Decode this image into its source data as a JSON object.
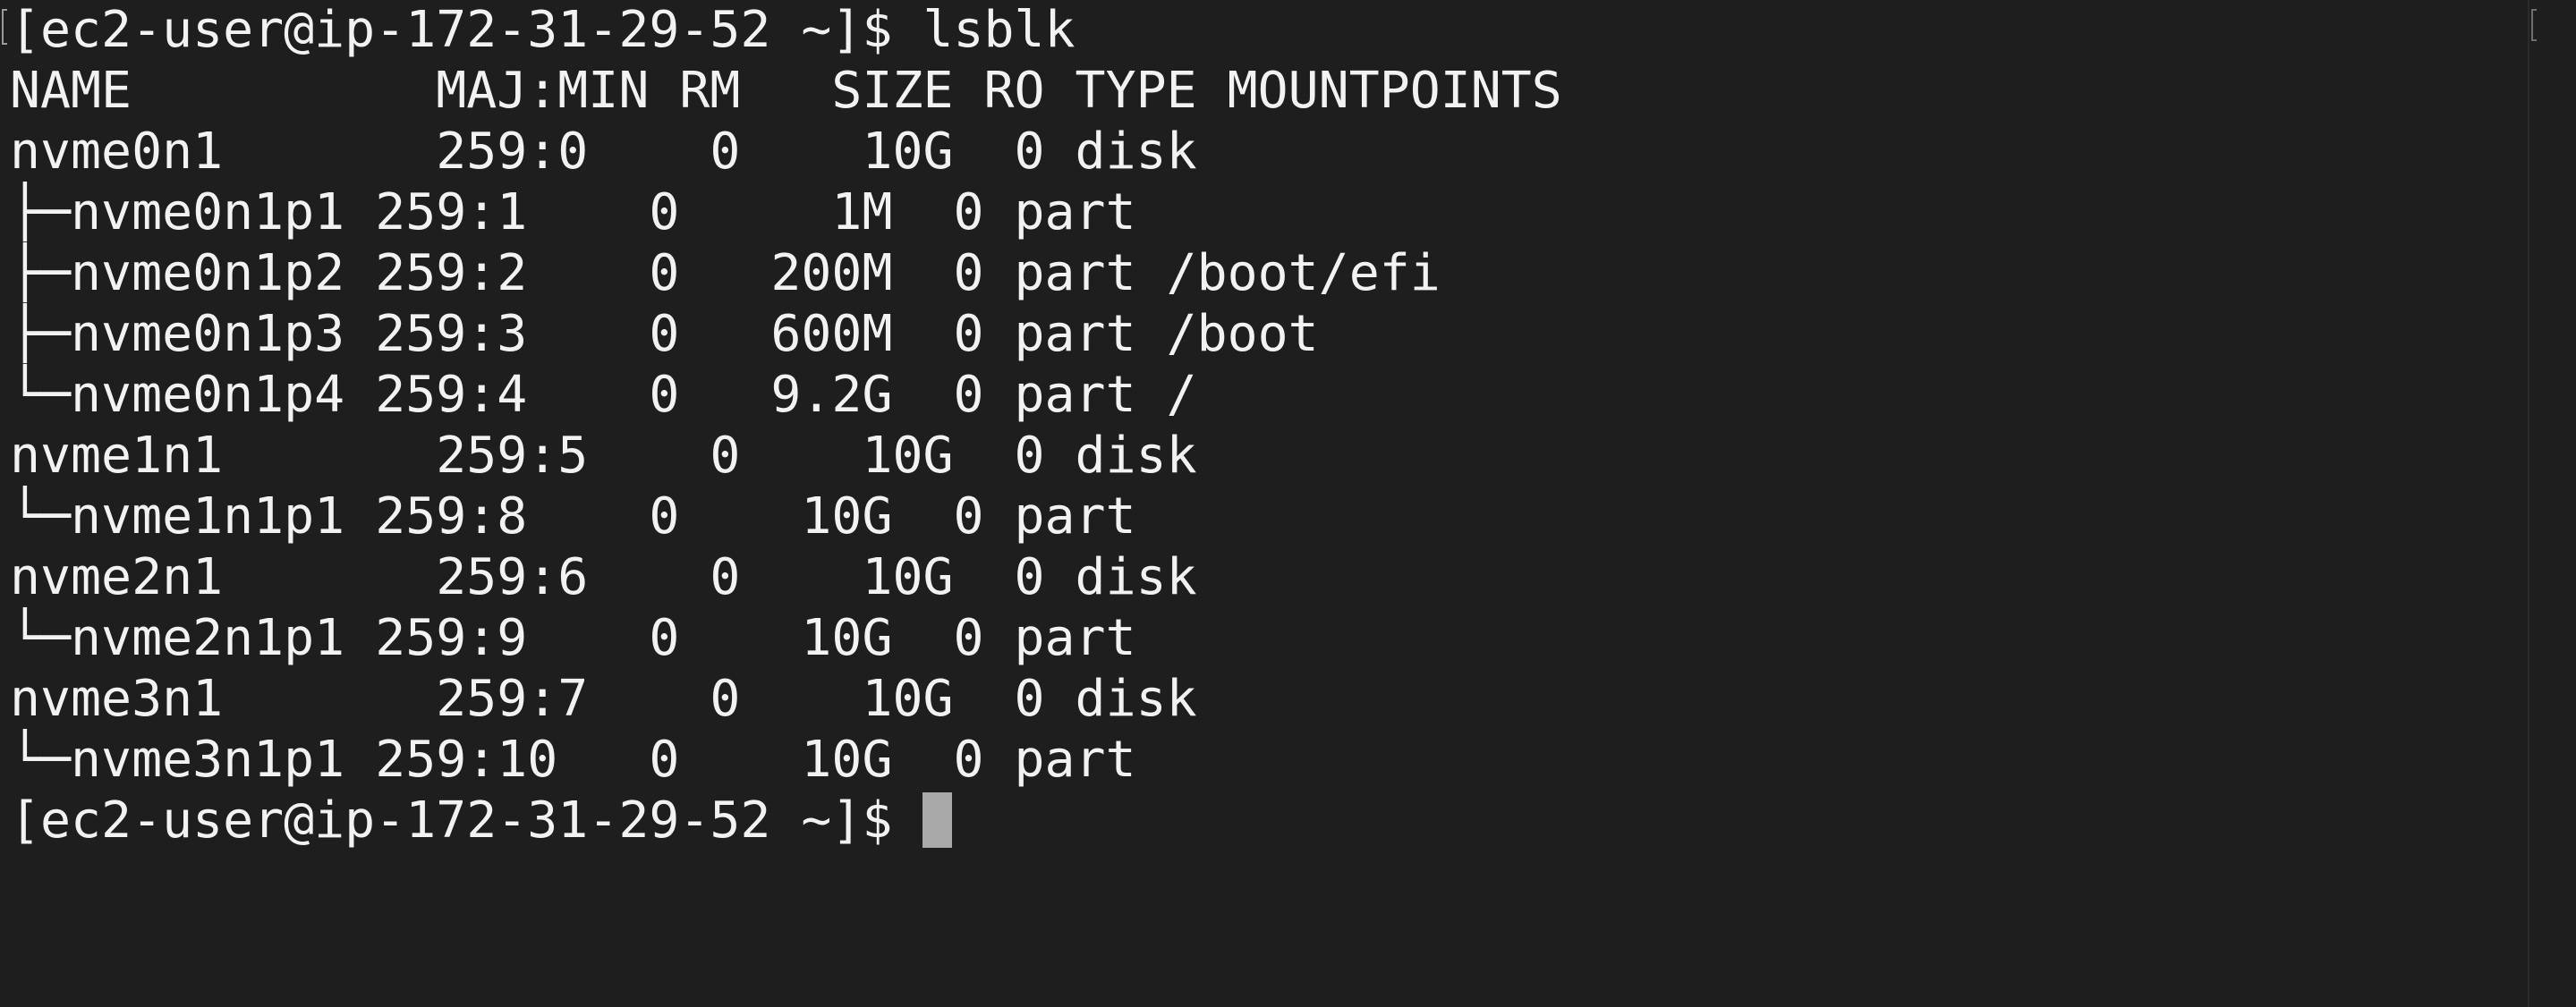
{
  "terminal": {
    "prompt_1": "[ec2-user@ip-172-31-29-52 ~]$ lsblk",
    "header": "NAME          MAJ:MIN RM   SIZE RO TYPE MOUNTPOINTS",
    "rows": [
      "nvme0n1       259:0    0    10G  0 disk ",
      "├─nvme0n1p1 259:1    0     1M  0 part ",
      "├─nvme0n1p2 259:2    0   200M  0 part /boot/efi",
      "├─nvme0n1p3 259:3    0   600M  0 part /boot",
      "└─nvme0n1p4 259:4    0   9.2G  0 part /",
      "nvme1n1       259:5    0    10G  0 disk ",
      "└─nvme1n1p1 259:8    0    10G  0 part ",
      "nvme2n1       259:6    0    10G  0 disk ",
      "└─nvme2n1p1 259:9    0    10G  0 part ",
      "nvme3n1       259:7    0    10G  0 disk ",
      "└─nvme3n1p1 259:10   0    10G  0 part "
    ],
    "prompt_2": "[ec2-user@ip-172-31-29-52 ~]$ ",
    "colors": {
      "background": "#1e1e1e",
      "foreground": "#f2f2f2",
      "cursor": "#a8a8a8"
    }
  }
}
